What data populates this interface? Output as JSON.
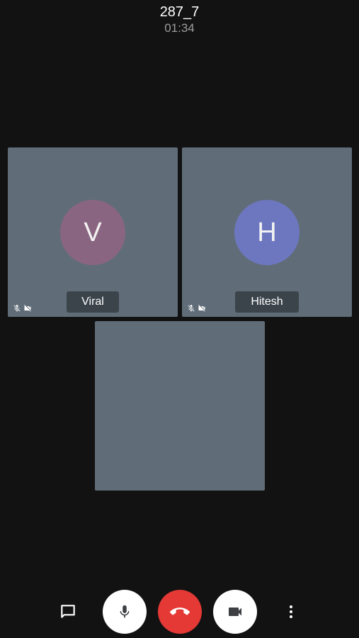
{
  "header": {
    "room_name": "287_7",
    "call_duration": "01:34"
  },
  "participants": [
    {
      "name": "Viral",
      "initial": "V",
      "avatar_color": "#8a6582",
      "muted": true,
      "video_off": true
    },
    {
      "name": "Hitesh",
      "initial": "H",
      "avatar_color": "#6d77c0",
      "muted": true,
      "video_off": true
    }
  ],
  "self_tile": {
    "video": "blank"
  },
  "controls": {
    "chat_icon": "chat-icon",
    "mic_icon": "microphone-icon",
    "end_call_icon": "end-call-icon",
    "camera_icon": "video-camera-icon",
    "more_icon": "more-vertical-icon"
  },
  "colors": {
    "background": "#121212",
    "tile": "#606d78",
    "end_call": "#e53935"
  }
}
